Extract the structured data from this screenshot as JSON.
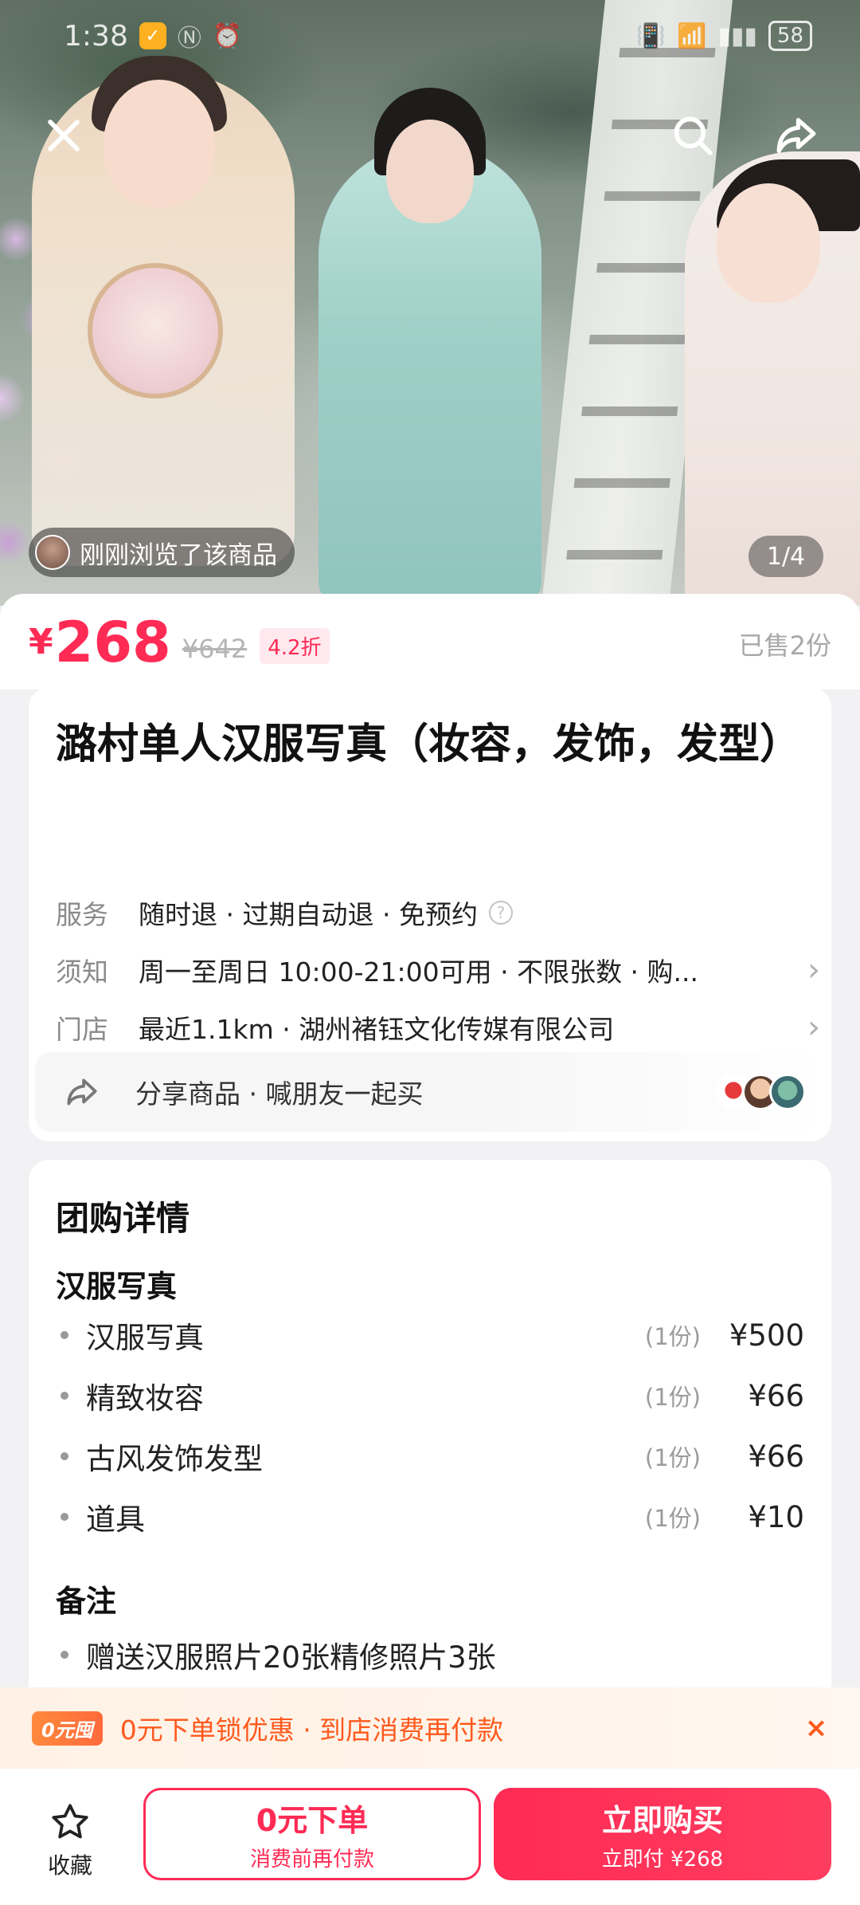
{
  "status_bar": {
    "time": "1:38",
    "battery": "58"
  },
  "hero": {
    "viewed_text": "刚刚浏览了该商品",
    "page_indicator": "1/4"
  },
  "price": {
    "currency": "¥",
    "current": "268",
    "original": "¥642",
    "discount": "4.2折",
    "sold": "已售2份"
  },
  "product": {
    "title": "潞村单人汉服写真（妆容，发饰，发型）",
    "service_label": "服务",
    "service_value": "随时退 · 过期自动退 · 免预约",
    "notice_label": "须知",
    "notice_value": "周一至周日 10:00-21:00可用 · 不限张数 · 购...",
    "store_label": "门店",
    "store_value": "最近1.1km · 湖州褚钰文化传媒有限公司",
    "share_text": "分享商品 · 喊朋友一起买"
  },
  "detail": {
    "title": "团购详情",
    "group_title": "汉服写真",
    "items": [
      {
        "name": "汉服写真",
        "qty": "(1份)",
        "price": "¥500"
      },
      {
        "name": "精致妆容",
        "qty": "(1份)",
        "price": "¥66"
      },
      {
        "name": "古风发饰发型",
        "qty": "(1份)",
        "price": "¥66"
      },
      {
        "name": "道具",
        "qty": "(1份)",
        "price": "¥10"
      }
    ],
    "note_title": "备注",
    "note_item": "赠送汉服照片20张精修照片3张"
  },
  "promo": {
    "badge": "0元囤",
    "text": "0元下单锁优惠 · 到店消费再付款",
    "close": "×"
  },
  "bottom_bar": {
    "favorite_label": "收藏",
    "zero_order_main": "0元下单",
    "zero_order_sub": "消费前再付款",
    "buy_main": "立即购买",
    "buy_sub": "立即付 ¥268"
  },
  "colors": {
    "accent": "#ff2b55",
    "promo": "#ff5a1e"
  },
  "icons": {
    "close": "close-icon",
    "search": "search-icon",
    "share": "share-icon",
    "help": "help-circle-icon",
    "chevron": "chevron-right-icon",
    "star": "star-icon"
  }
}
